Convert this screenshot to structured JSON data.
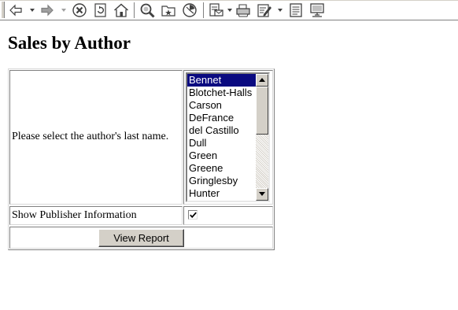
{
  "toolbar": {
    "icons": [
      "back-icon",
      "forward-icon",
      "stop-icon",
      "refresh-icon",
      "home-icon",
      "search-icon",
      "favorites-icon",
      "history-icon",
      "mail-icon",
      "print-icon",
      "edit-icon",
      "discuss-icon",
      "messenger-icon"
    ]
  },
  "page": {
    "title": "Sales by Author"
  },
  "form": {
    "author_prompt": "Please select the author's last name.",
    "authors": [
      "Bennet",
      "Blotchet-Halls",
      "Carson",
      "DeFrance",
      "del Castillo",
      "Dull",
      "Green",
      "Greene",
      "Gringlesby",
      "Hunter"
    ],
    "selected_author": "Bennet",
    "publisher_label": "Show Publisher Information",
    "publisher_checked": true,
    "view_report_label": "View Report"
  }
}
